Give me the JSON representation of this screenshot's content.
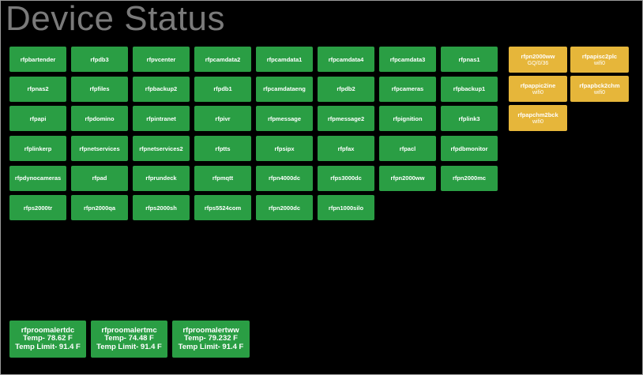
{
  "title": "Device Status",
  "colors": {
    "ok": "#2a9e44",
    "warning": "#e6b63a",
    "background": "#000000",
    "title": "#7a7a7a"
  },
  "devices": [
    "rfpbartender",
    "rfpdb3",
    "rfpvcenter",
    "rfpcamdata2",
    "rfpcamdata1",
    "rfpcamdata4",
    "rfpcamdata3",
    "rfpnas1",
    "rfpnas2",
    "rfpfiles",
    "rfpbackup2",
    "rfpdb1",
    "rfpcamdataeng",
    "rfpdb2",
    "rfpcameras",
    "rfpbackup1",
    "rfpapi",
    "rfpdomino",
    "rfpintranet",
    "rfpivr",
    "rfpmessage",
    "rfpmessage2",
    "rfpignition",
    "rfplink3",
    "rfplinkerp",
    "rfpnetservices",
    "rfpnetservices2",
    "rfptts",
    "rfpsipx",
    "rfpfax",
    "rfpacl",
    "rfpdbmonitor",
    "rfpdynocameras",
    "rfpad",
    "rfprundeck",
    "rfpmqtt",
    "rfpn4000dc",
    "rfps3000dc",
    "rfpn2000ww",
    "rfpn2000mc",
    "rfps2000tr",
    "rfpn2000qa",
    "rfps2000sh",
    "rfps5524com",
    "rfpn2000dc",
    "rfpn1000silo"
  ],
  "warning_devices": [
    {
      "name": "rfpn2000ww",
      "detail": "GQ/0/36"
    },
    {
      "name": "rfpapisc2plc",
      "detail": "wifi0"
    },
    {
      "name": "rfpappic2ine",
      "detail": "wifi0"
    },
    {
      "name": "rfpapbck2chm",
      "detail": "wifi0"
    },
    {
      "name": "rfpapchm2bck",
      "detail": "wifi0"
    }
  ],
  "room_alerts": [
    {
      "name": "rfproomalertdc",
      "temp": "Temp- 78.62 F",
      "limit": "Temp Limit- 91.4 F"
    },
    {
      "name": "rfproomalertmc",
      "temp": "Temp- 74.48 F",
      "limit": "Temp Limit- 91.4 F"
    },
    {
      "name": "rfproomalertww",
      "temp": "Temp- 79.232 F",
      "limit": "Temp Limit- 91.4 F"
    }
  ]
}
